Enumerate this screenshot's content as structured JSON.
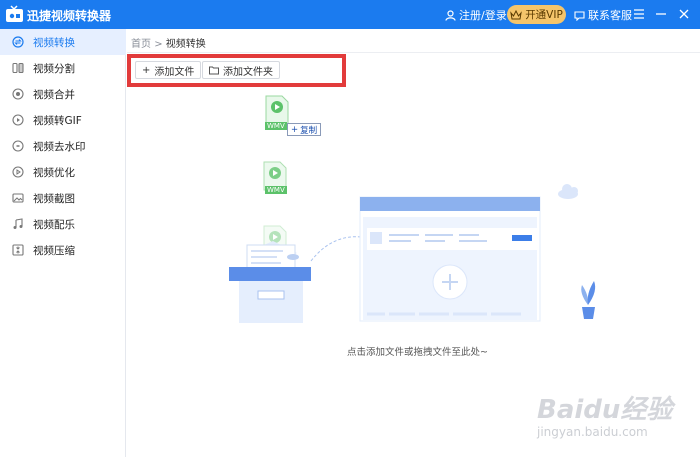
{
  "app": {
    "title": "迅捷视频转换器",
    "login_label": "注册/登录",
    "vip_label": "开通VIP",
    "service_label": "联系客服",
    "accent_color": "#1b7bef"
  },
  "window_controls": [
    "menu-icon",
    "minimize-icon",
    "close-icon"
  ],
  "sidebar": {
    "items": [
      {
        "label": "视频转换",
        "icon": "convert-icon",
        "active": true
      },
      {
        "label": "视频分割",
        "icon": "split-icon",
        "active": false
      },
      {
        "label": "视频合并",
        "icon": "merge-icon",
        "active": false
      },
      {
        "label": "视频转GIF",
        "icon": "gif-icon",
        "active": false
      },
      {
        "label": "视频去水印",
        "icon": "watermark-icon",
        "active": false
      },
      {
        "label": "视频优化",
        "icon": "optimize-icon",
        "active": false
      },
      {
        "label": "视频截图",
        "icon": "screenshot-icon",
        "active": false
      },
      {
        "label": "视频配乐",
        "icon": "music-icon",
        "active": false
      },
      {
        "label": "视频压缩",
        "icon": "compress-icon",
        "active": false
      }
    ]
  },
  "breadcrumb": {
    "home": "首页",
    "separator": ">",
    "current": "视频转换"
  },
  "toolbar": {
    "add_file_label": "添加文件",
    "add_folder_label": "添加文件夹"
  },
  "drag": {
    "file_badge": "WMV",
    "copy_tooltip": "复制"
  },
  "empty_state": {
    "hint": "点击添加文件或拖拽文件至此处~"
  },
  "watermark": {
    "logo": "Baidu经验",
    "url": "jingyan.baidu.com"
  }
}
